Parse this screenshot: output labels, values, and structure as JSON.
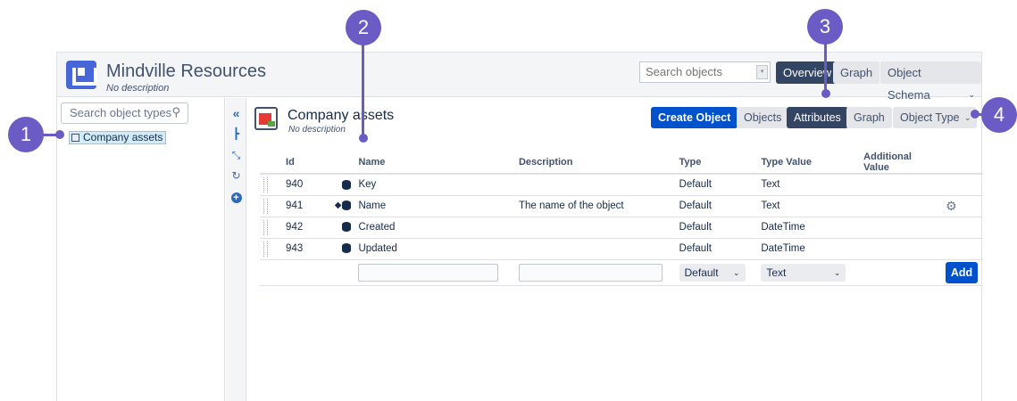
{
  "header": {
    "app_title": "Mindville Resources",
    "app_description": "No description",
    "search_placeholder": "Search objects",
    "tabs": [
      {
        "label": "Overview",
        "active": true
      },
      {
        "label": "Graph",
        "active": false
      },
      {
        "label": "Object Schema",
        "active": false
      }
    ]
  },
  "sidebar": {
    "search_placeholder": "Search object types",
    "items": [
      {
        "label": "Company assets",
        "selected": true
      }
    ]
  },
  "toolbar": {
    "icons": [
      "collapse-icon",
      "hierarchy-icon",
      "expand-icon",
      "refresh-icon",
      "add-icon"
    ]
  },
  "main": {
    "title": "Company assets",
    "description": "No description",
    "create_label": "Create Object",
    "tabs": [
      {
        "label": "Objects",
        "active": false
      },
      {
        "label": "Attributes",
        "active": true
      },
      {
        "label": "Graph",
        "active": false
      }
    ],
    "object_type_label": "Object Type"
  },
  "table": {
    "columns": [
      "Id",
      "Name",
      "Description",
      "Type",
      "Type Value",
      "Additional Value"
    ],
    "rows": [
      {
        "id": "940",
        "name": "Key",
        "description": "",
        "type": "Default",
        "type_value": "Text",
        "additional": ""
      },
      {
        "id": "941",
        "name": "Name",
        "description": "The name of the object",
        "type": "Default",
        "type_value": "Text",
        "additional": ""
      },
      {
        "id": "942",
        "name": "Created",
        "description": "",
        "type": "Default",
        "type_value": "DateTime",
        "additional": ""
      },
      {
        "id": "943",
        "name": "Updated",
        "description": "",
        "type": "Default",
        "type_value": "DateTime",
        "additional": ""
      }
    ],
    "new_row": {
      "type_select": "Default",
      "type_value_select": "Text",
      "add_label": "Add"
    }
  },
  "callouts": [
    "1",
    "2",
    "3",
    "4"
  ],
  "colors": {
    "callout": "#6b5bc4",
    "primary": "#0052cc",
    "active_tab": "#344563"
  }
}
